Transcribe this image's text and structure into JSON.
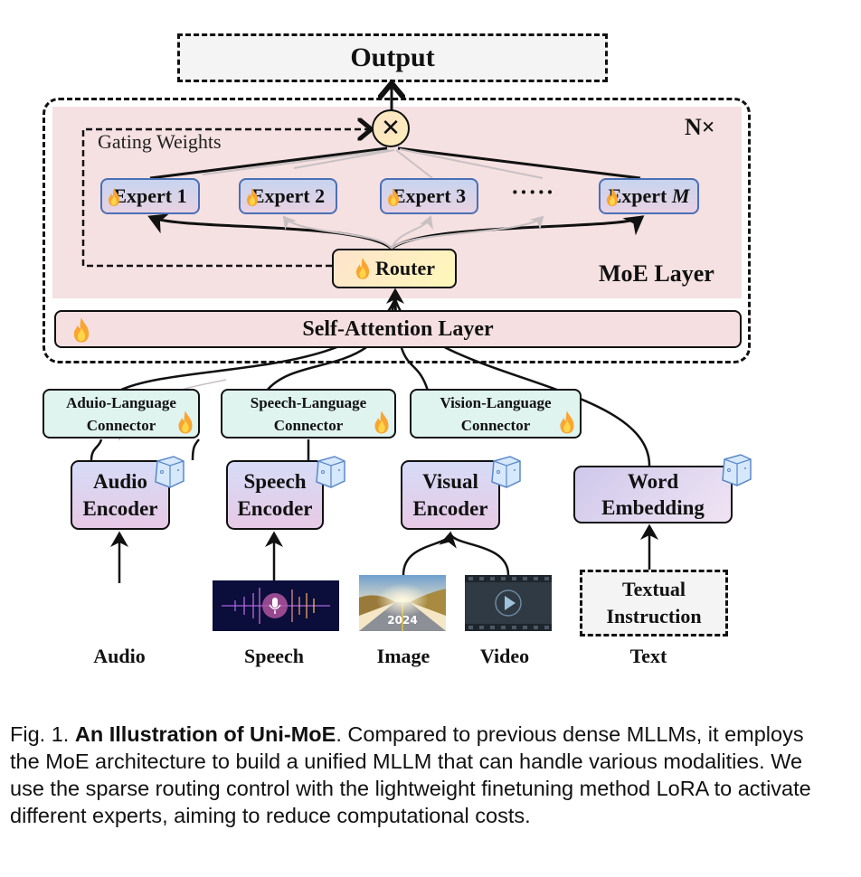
{
  "diagram": {
    "output": "Output",
    "repeat": "N×",
    "gating_weights": "Gating Weights",
    "multiply_symbol": "✕",
    "experts": [
      {
        "label": "Expert 1"
      },
      {
        "label": "Expert 2"
      },
      {
        "label": "Expert 3"
      },
      {
        "label": "Expert ",
        "italic_suffix": "M"
      }
    ],
    "ellipsis": "·····",
    "router": "Router",
    "moe_layer": "MoE Layer",
    "self_attention": "Self-Attention Layer",
    "connectors": [
      {
        "line1": "Aduio-Language",
        "line2": "Connector"
      },
      {
        "line1": "Speech-Language",
        "line2": "Connector"
      },
      {
        "line1": "Vision-Language",
        "line2": "Connector"
      }
    ],
    "encoders": [
      {
        "line1": "Audio",
        "line2": "Encoder"
      },
      {
        "line1": "Speech",
        "line2": "Encoder"
      },
      {
        "line1": "Visual",
        "line2": "Encoder"
      }
    ],
    "word_embedding": {
      "line1": "Word",
      "line2": "Embedding"
    },
    "textual_instruction": {
      "line1": "Textual",
      "line2": "Instruction"
    },
    "image_year": "2024",
    "modalities": [
      "Audio",
      "Speech",
      "Image",
      "Video",
      "Text"
    ],
    "legend_icons": {
      "trainable": "flame-icon",
      "frozen": "ice-cube-icon"
    }
  },
  "caption": {
    "prefix": "Fig. 1. ",
    "bold": "An Illustration of Uni-MoE",
    "text": ". Compared to previous dense MLLMs, it employs the MoE architecture to build a unified MLLM that can handle various modalities. We use the sparse routing control with the lightweight finetuning method LoRA to activate different experts, aiming to reduce computational costs."
  },
  "colors": {
    "moe_bg": "#f5e0e2",
    "expert_border": "#4a6fb5",
    "connector_bg": "#dff3ef",
    "router_bg": "#fef8b9",
    "encoder_top": "#d6dcf7",
    "encoder_bottom": "#e7c9e5"
  }
}
